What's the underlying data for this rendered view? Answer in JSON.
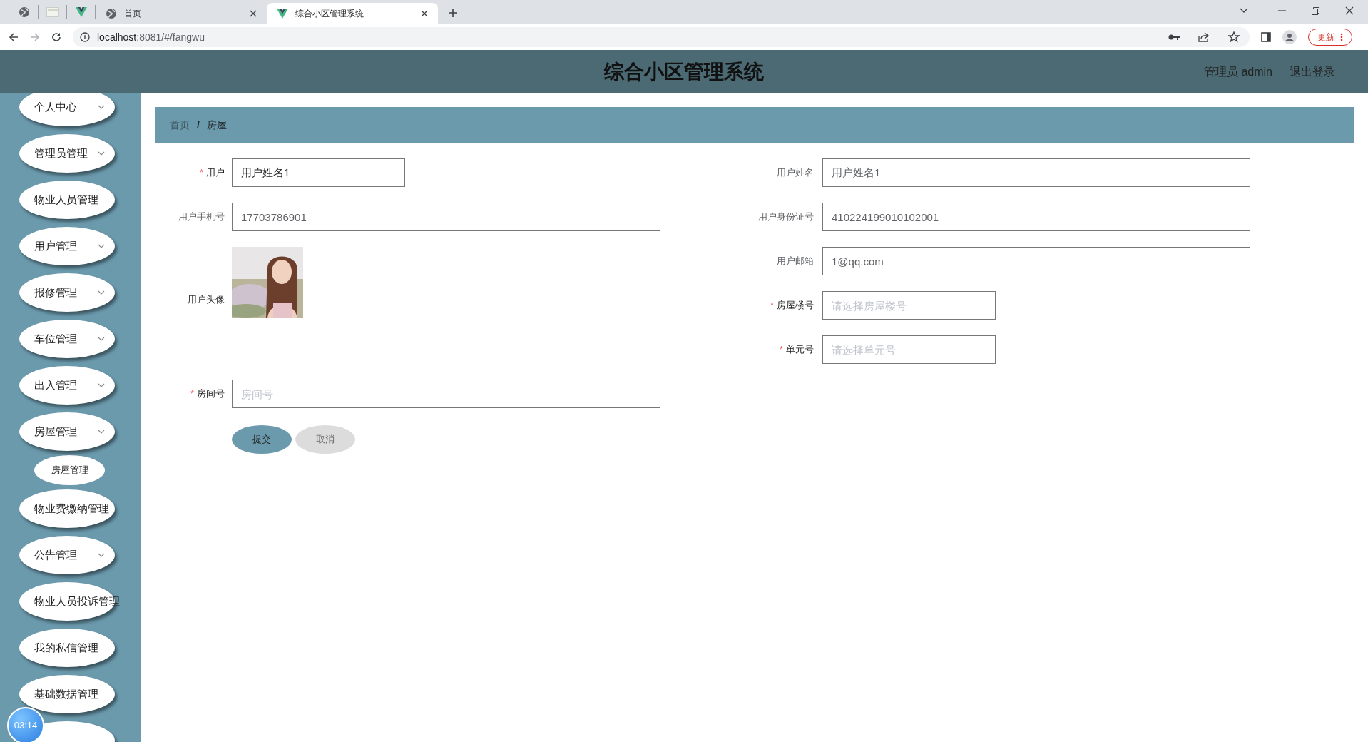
{
  "browser": {
    "tabs": [
      {
        "kind": "icon",
        "selected": false
      },
      {
        "kind": "icon",
        "selected": false
      },
      {
        "kind": "icon",
        "selected": false
      },
      {
        "kind": "full",
        "title": "首页",
        "selected": false
      },
      {
        "kind": "full",
        "title": "综合小区管理系统",
        "selected": true
      }
    ],
    "url_host": "localhost",
    "url_rest": ":8081/#/fangwu",
    "update_button": "更新"
  },
  "header": {
    "title": "综合小区管理系统",
    "user": "管理员 admin",
    "logout": "退出登录"
  },
  "sidebar": {
    "items": [
      {
        "label": "个人中心",
        "expandable": true
      },
      {
        "label": "管理员管理",
        "expandable": true
      },
      {
        "label": "物业人员管理",
        "expandable": false
      },
      {
        "label": "用户管理",
        "expandable": true
      },
      {
        "label": "报修管理",
        "expandable": true
      },
      {
        "label": "车位管理",
        "expandable": true
      },
      {
        "label": "出入管理",
        "expandable": true
      },
      {
        "label": "房屋管理",
        "expandable": true,
        "expanded": true,
        "children": [
          {
            "label": "房屋管理"
          }
        ]
      },
      {
        "label": "物业费缴纳管理",
        "expandable": false
      },
      {
        "label": "公告管理",
        "expandable": true
      },
      {
        "label": "物业人员投诉管理",
        "expandable": false
      },
      {
        "label": "我的私信管理",
        "expandable": false
      },
      {
        "label": "基础数据管理",
        "expandable": false
      }
    ],
    "timer": "03:14"
  },
  "breadcrumb": [
    {
      "label": "首页",
      "current": false
    },
    {
      "label": "房屋",
      "current": true
    }
  ],
  "breadcrumb_separator": "/",
  "form": {
    "left": [
      {
        "kind": "select",
        "label": "用户",
        "required": true,
        "value": "用户姓名1"
      },
      {
        "kind": "input",
        "label": "用户手机号",
        "required": false,
        "value": "17703786901"
      },
      {
        "label": "用户头像",
        "required": false
      },
      {
        "kind": "input",
        "label": "房间号",
        "required": true,
        "placeholder": "房间号"
      }
    ],
    "right": [
      {
        "kind": "input",
        "label": "用户姓名",
        "required": false,
        "value": "用户姓名1"
      },
      {
        "kind": "input",
        "label": "用户身份证号",
        "required": false,
        "value": "410224199010102001"
      },
      {
        "kind": "input",
        "label": "用户邮箱",
        "required": false,
        "value": "1@qq.com"
      },
      {
        "kind": "select",
        "label": "房屋楼号",
        "required": true,
        "placeholder": "请选择房屋楼号"
      },
      {
        "kind": "select",
        "label": "单元号",
        "required": true,
        "placeholder": "请选择单元号"
      }
    ],
    "required_mark": "*",
    "buttons": [
      {
        "kind": "primary",
        "label": "提交"
      },
      {
        "kind": "secondary",
        "label": "取消"
      }
    ]
  }
}
